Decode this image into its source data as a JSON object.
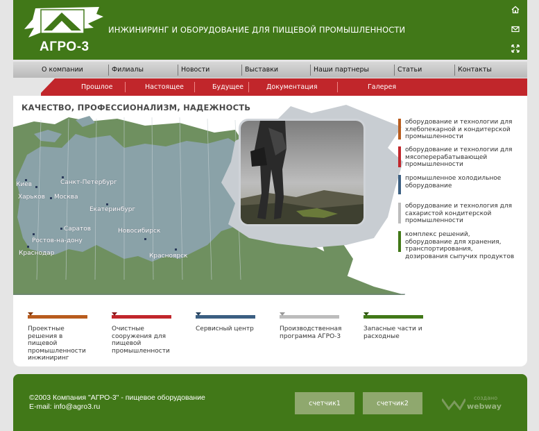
{
  "header": {
    "brand": "АГРО-3",
    "tagline": "ИНЖИНИРИНГ И ОБОРУДОВАНИЕ ДЛЯ ПИЩЕВОЙ ПРОМЫШЛЕННОСТИ"
  },
  "nav": {
    "items": [
      {
        "label": "О компании"
      },
      {
        "label": "Филиалы"
      },
      {
        "label": "Новости"
      },
      {
        "label": "Выставки"
      },
      {
        "label": "Наши партнеры"
      },
      {
        "label": "Статьи"
      },
      {
        "label": "Контакты"
      }
    ]
  },
  "subnav": {
    "items": [
      {
        "label": "Прошлое"
      },
      {
        "label": "Настоящее"
      },
      {
        "label": "Будущее"
      },
      {
        "label": "Документация"
      },
      {
        "label": "Галерея"
      }
    ]
  },
  "main": {
    "headline": "КАЧЕСТВО, ПРОФЕССИОНАЛИЗМ, НАДЕЖНОСТЬ",
    "cities": [
      {
        "name": "Киев"
      },
      {
        "name": "Санкт-Петербург"
      },
      {
        "name": "Харьков"
      },
      {
        "name": "Москва"
      },
      {
        "name": "Екатеринбург"
      },
      {
        "name": "Саратов"
      },
      {
        "name": "Новосибирск"
      },
      {
        "name": "Ростов-на-дону"
      },
      {
        "name": "Красноярск"
      },
      {
        "name": "Краснодар"
      }
    ],
    "categories": [
      {
        "text": "оборудование и технологии для хлебопекарной и кондитерской промышленности",
        "color": "#b85c1e"
      },
      {
        "text": "оборудование и технологии для  мясоперерабатывающей промышленности",
        "color": "#c1262b"
      },
      {
        "text": "промышленное холодильное оборудование",
        "color": "#3b5f82"
      },
      {
        "text": "оборудование и технология для сахаристой кондитерской промышленности",
        "color": "#bcbcbc"
      },
      {
        "text": "комплекс решений, оборудование для хранения, транспортирования, дозирования сыпучих продуктов",
        "color": "#417818"
      }
    ],
    "sections": [
      {
        "label": "Проектные решения в пищевой промышленности инжиниринг",
        "color": "#b85c1e",
        "tri": "#8a3d10"
      },
      {
        "label": "Очистные сооружения для пищевой промышленности",
        "color": "#c1262b",
        "tri": "#8a1a1d"
      },
      {
        "label": "Сервисный центр",
        "color": "#3b5f82",
        "tri": "#2a4560"
      },
      {
        "label": "Производственная программа АГРО-3",
        "color": "#bcbcbc",
        "tri": "#999999"
      },
      {
        "label": "Запасные части и расходные",
        "color": "#417818",
        "tri": "#2e5610"
      }
    ]
  },
  "footer": {
    "copyright": "©2003 Компания \"АГРО-3\"  -  пищевое оборудование",
    "email": "E-mail: info@agro3.ru",
    "counter1": "счетчик1",
    "counter2": "счетчик2",
    "webway_small": "создано",
    "webway_big": "webway"
  },
  "colors": {
    "green": "#417818",
    "red": "#c1262b",
    "map_land": "#8aa2a8",
    "map_green": "#6f9060"
  },
  "icons": [
    "home-icon",
    "mail-icon",
    "sitemap-icon"
  ]
}
